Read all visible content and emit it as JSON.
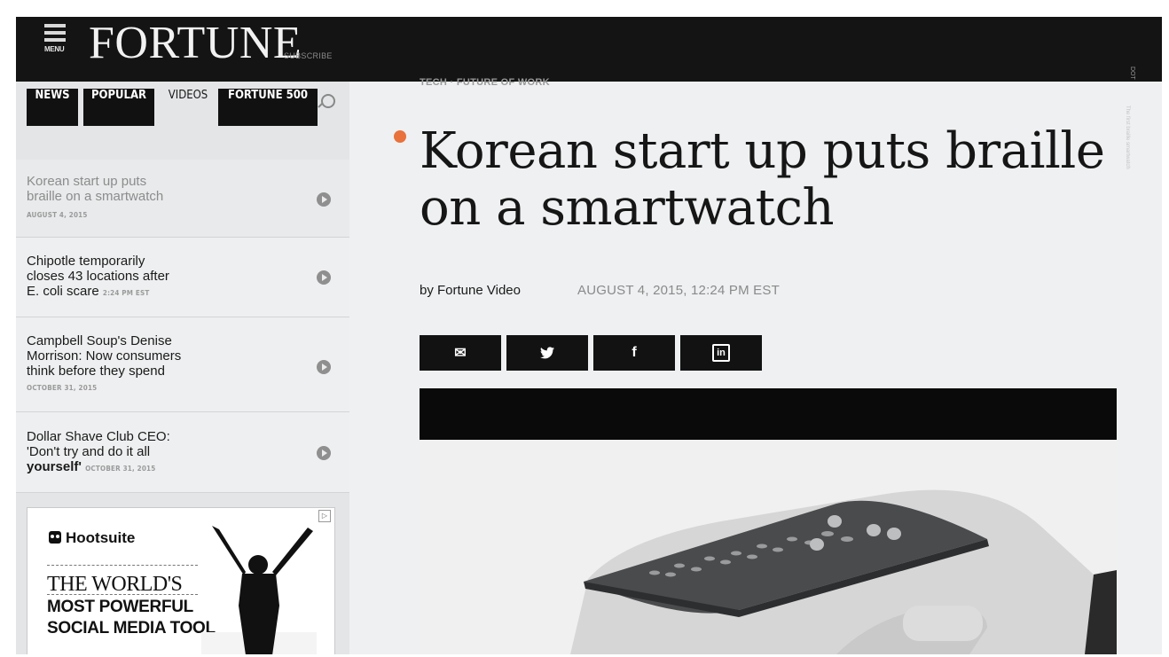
{
  "header": {
    "menu_label": "MENU",
    "logo": "FORTUNE",
    "subscribe": "SUBSCRIBE",
    "edge_tag": "DOT"
  },
  "sidebar": {
    "tabs": [
      {
        "label": "NEWS"
      },
      {
        "label": "POPULAR"
      },
      {
        "label": "VIDEOS"
      },
      {
        "label": "FORTUNE 500"
      }
    ],
    "items": [
      {
        "lines": [
          "Korean start up puts",
          "braille on a smartwatch"
        ],
        "date": "AUGUST 4, 2015"
      },
      {
        "lines": [
          "Chipotle temporarily",
          "closes 43 locations after",
          "E. coli scare"
        ],
        "date": "2:24 PM EST"
      },
      {
        "lines": [
          "Campbell Soup's Denise",
          "Morrison: Now consumers",
          "think before they spend"
        ],
        "date": "OCTOBER 31, 2015"
      },
      {
        "lines": [
          "Dollar Shave Club CEO:",
          "'Don't try and do it all",
          "yourself'"
        ],
        "date": "OCTOBER 31, 2015"
      }
    ]
  },
  "ad": {
    "brand": "Hootsuite",
    "line1": "THE WORLD'S",
    "line2": "MOST POWERFUL",
    "line3": "SOCIAL MEDIA TOOL"
  },
  "article": {
    "breadcrumb": "TECH · FUTURE OF WORK",
    "headline_line1": "Korean start up puts braille",
    "headline_line2": "on a smartwatch",
    "byline": "by Fortune Video",
    "date": "AUGUST 4, 2015, 12:24 PM EST",
    "share": [
      {
        "icon": "email-icon",
        "glyph": "✉"
      },
      {
        "icon": "twitter-icon",
        "glyph": "🐦"
      },
      {
        "icon": "facebook-icon",
        "glyph": "f"
      },
      {
        "icon": "linkedin-icon",
        "glyph": "in"
      }
    ],
    "side_caption": "The first braille smartwatch"
  },
  "colors": {
    "topbar": "#141414",
    "accent_dot": "#e8713c",
    "background": "#eef0f1"
  }
}
